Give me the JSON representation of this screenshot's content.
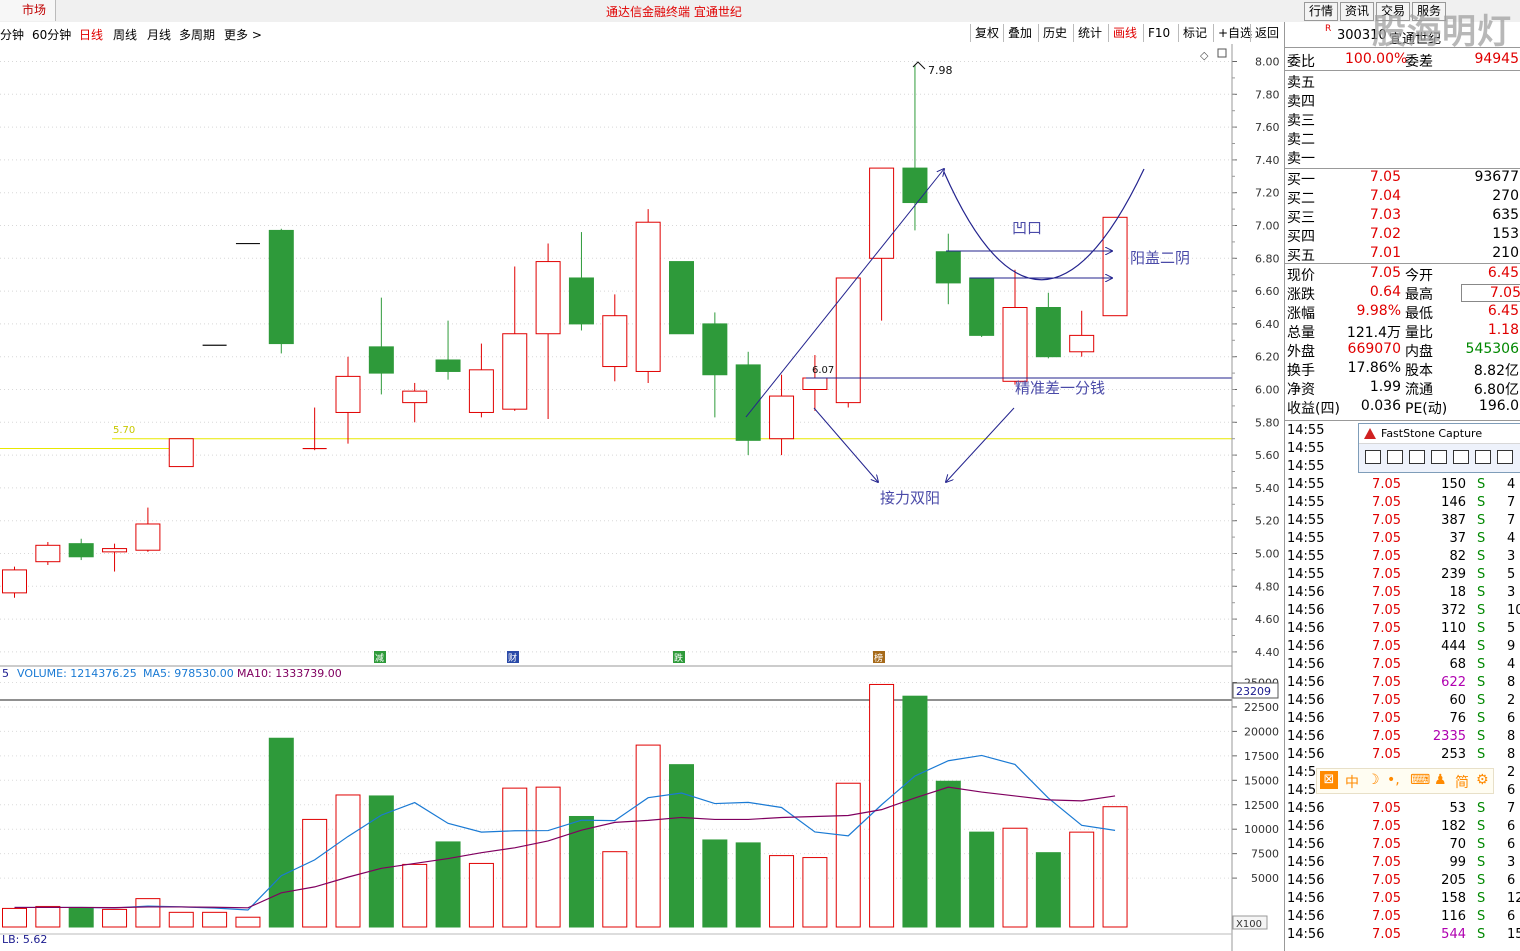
{
  "topbar": {
    "market": "市场",
    "title": "通达信金融终端  宜通世纪",
    "buttons": [
      "行情",
      "资讯",
      "交易",
      "服务"
    ]
  },
  "toolbar": {
    "periods": [
      "分钟",
      "60分钟",
      "日线",
      "周线",
      "月线",
      "多周期",
      "更多 >"
    ],
    "active_period": "日线",
    "tools": [
      "复权",
      "叠加",
      "历史",
      "统计",
      "画线",
      "F10",
      "标记",
      "+自选",
      "返回"
    ],
    "active_tool": "画线"
  },
  "colors": {
    "up": "#e00000",
    "down": "#2e9a3a",
    "support": "#e8e800",
    "drawing": "#23238e",
    "ma5": "#1a7ad4",
    "ma10": "#800060"
  },
  "price_axis": {
    "ticks": [
      "8.00",
      "7.80",
      "7.60",
      "7.40",
      "7.20",
      "7.00",
      "6.80",
      "6.60",
      "6.40",
      "6.20",
      "6.00",
      "5.80",
      "5.60",
      "5.40",
      "5.20",
      "5.00",
      "4.80",
      "4.60",
      "4.40"
    ]
  },
  "volume_axis": {
    "ticks": [
      "25000",
      "22500",
      "20000",
      "17500",
      "15000",
      "12500",
      "10000",
      "7500",
      "5000"
    ],
    "unit": "X100",
    "cursor_value": "23209"
  },
  "chart_data": {
    "type": "candlestick",
    "candles": [
      {
        "o": 4.76,
        "c": 4.9,
        "h": 4.92,
        "l": 4.73
      },
      {
        "o": 4.95,
        "c": 5.05,
        "h": 5.07,
        "l": 4.93
      },
      {
        "o": 5.06,
        "c": 4.98,
        "h": 5.09,
        "l": 4.96
      },
      {
        "o": 5.01,
        "c": 5.03,
        "h": 5.06,
        "l": 4.89
      },
      {
        "o": 5.02,
        "c": 5.18,
        "h": 5.28,
        "l": 5.01
      },
      {
        "o": 5.53,
        "c": 5.7,
        "h": 5.7,
        "l": 5.53
      },
      {
        "o": 6.27,
        "c": 6.27,
        "h": 6.27,
        "l": 6.27
      },
      {
        "o": 6.89,
        "c": 6.89,
        "h": 6.89,
        "l": 6.89
      },
      {
        "o": 6.97,
        "c": 6.28,
        "h": 6.98,
        "l": 6.22
      },
      {
        "o": 5.64,
        "c": 5.64,
        "h": 5.89,
        "l": 5.63
      },
      {
        "o": 5.86,
        "c": 6.08,
        "h": 6.2,
        "l": 5.67
      },
      {
        "o": 6.26,
        "c": 6.1,
        "h": 6.56,
        "l": 5.97
      },
      {
        "o": 5.92,
        "c": 5.99,
        "h": 6.04,
        "l": 5.8
      },
      {
        "o": 6.18,
        "c": 6.11,
        "h": 6.42,
        "l": 6.06
      },
      {
        "o": 5.86,
        "c": 6.12,
        "h": 6.28,
        "l": 5.83
      },
      {
        "o": 5.88,
        "c": 6.34,
        "h": 6.75,
        "l": 5.87
      },
      {
        "o": 6.34,
        "c": 6.78,
        "h": 6.89,
        "l": 5.82
      },
      {
        "o": 6.68,
        "c": 6.4,
        "h": 6.96,
        "l": 6.36
      },
      {
        "o": 6.14,
        "c": 6.45,
        "h": 6.58,
        "l": 6.05
      },
      {
        "o": 6.11,
        "c": 7.02,
        "h": 7.1,
        "l": 6.04
      },
      {
        "o": 6.78,
        "c": 6.34,
        "h": 6.78,
        "l": 6.34
      },
      {
        "o": 6.4,
        "c": 6.09,
        "h": 6.47,
        "l": 5.83
      },
      {
        "o": 6.15,
        "c": 5.69,
        "h": 6.23,
        "l": 5.6
      },
      {
        "o": 5.7,
        "c": 5.96,
        "h": 6.09,
        "l": 5.6
      },
      {
        "o": 6.0,
        "c": 6.07,
        "h": 6.21,
        "l": 5.87
      },
      {
        "o": 5.92,
        "c": 6.68,
        "h": 6.68,
        "l": 5.89
      },
      {
        "o": 6.8,
        "c": 7.35,
        "h": 7.35,
        "l": 6.42
      },
      {
        "o": 7.35,
        "c": 7.14,
        "h": 7.98,
        "l": 6.97
      },
      {
        "o": 6.84,
        "c": 6.65,
        "h": 6.95,
        "l": 6.52
      },
      {
        "o": 6.68,
        "c": 6.33,
        "h": 6.68,
        "l": 6.32
      },
      {
        "o": 6.05,
        "c": 6.5,
        "h": 6.73,
        "l": 6.03
      },
      {
        "o": 6.5,
        "c": 6.2,
        "h": 6.59,
        "l": 6.19
      },
      {
        "o": 6.23,
        "c": 6.33,
        "h": 6.48,
        "l": 6.2
      },
      {
        "o": 6.45,
        "c": 7.05,
        "h": 7.05,
        "l": 6.45
      }
    ],
    "volumes": [
      1900,
      2100,
      2000,
      1800,
      2900,
      1500,
      1500,
      1000,
      19300,
      11000,
      13500,
      13400,
      6400,
      8700,
      6500,
      14200,
      14300,
      11300,
      7700,
      18600,
      16600,
      8900,
      8600,
      7300,
      7100,
      14700,
      24800,
      23600,
      14900,
      9700,
      10100,
      7600,
      9700,
      12300
    ],
    "ma5": [
      2000,
      2000,
      2000,
      1950,
      2140,
      2060,
      1940,
      1740,
      5240,
      6860,
      9260,
      11440,
      12720,
      10600,
      9700,
      9840,
      9860,
      10920,
      10880,
      13220,
      13700,
      12620,
      12740,
      12220,
      9720,
      9320,
      12500,
      15440,
      17000,
      17540,
      16620,
      13180,
      10400,
      9880
    ],
    "ma10": [
      2000,
      2000,
      2000,
      1980,
      2050,
      2050,
      2020,
      1960,
      3500,
      4100,
      5100,
      6000,
      6500,
      7000,
      7600,
      8100,
      8800,
      9900,
      10700,
      10900,
      11200,
      11000,
      11000,
      11200,
      11300,
      11400,
      12000,
      13200,
      14300,
      13800,
      13400,
      13000,
      12900,
      13400
    ]
  },
  "header": {
    "volume_label": "VOLUME: 1214376.25",
    "ma5_label": "MA5: 978530.00",
    "ma10_label": "MA10: 1333739.00",
    "left_edge": "5",
    "bottom_left": "LB: 5.62"
  },
  "annotations": {
    "high_label": "7.98",
    "support_label": "5.70",
    "level_label": "6.07",
    "notch": "凹口",
    "cover": "阳盖二阴",
    "precise": "精准差一分钱",
    "relay": "接力双阳",
    "event_markers": [
      "减",
      "财",
      "跌",
      "榜"
    ]
  },
  "quote": {
    "code": "300310",
    "name": "宜通世纪",
    "wb_label": "委比",
    "wb_value": "100.00%",
    "wc_label": "委差",
    "wc_value": "94945",
    "sells": [
      {
        "label": "卖五",
        "price": "",
        "vol": ""
      },
      {
        "label": "卖四",
        "price": "",
        "vol": ""
      },
      {
        "label": "卖三",
        "price": "",
        "vol": ""
      },
      {
        "label": "卖二",
        "price": "",
        "vol": ""
      },
      {
        "label": "卖一",
        "price": "",
        "vol": ""
      }
    ],
    "buys": [
      {
        "label": "买一",
        "price": "7.05",
        "vol": "93677"
      },
      {
        "label": "买二",
        "price": "7.04",
        "vol": "270"
      },
      {
        "label": "买三",
        "price": "7.03",
        "vol": "635"
      },
      {
        "label": "买四",
        "price": "7.02",
        "vol": "153"
      },
      {
        "label": "买五",
        "price": "7.01",
        "vol": "210"
      }
    ],
    "stats": [
      {
        "l1": "现价",
        "v1": "7.05",
        "c1": "red",
        "l2": "今开",
        "v2": "6.45",
        "c2": "red"
      },
      {
        "l1": "涨跌",
        "v1": "0.64",
        "c1": "red",
        "l2": "最高",
        "v2": "7.05",
        "c2": "red"
      },
      {
        "l1": "涨幅",
        "v1": "9.98%",
        "c1": "red",
        "l2": "最低",
        "v2": "6.45",
        "c2": "red"
      },
      {
        "l1": "总量",
        "v1": "121.4万",
        "c1": "black",
        "l2": "量比",
        "v2": "1.18",
        "c2": "red"
      },
      {
        "l1": "外盘",
        "v1": "669070",
        "c1": "red",
        "l2": "内盘",
        "v2": "545306",
        "c2": "green"
      },
      {
        "l1": "换手",
        "v1": "17.86%",
        "c1": "black",
        "l2": "股本",
        "v2": "8.82亿",
        "c2": "black"
      },
      {
        "l1": "净资",
        "v1": "1.99",
        "c1": "black",
        "l2": "流通",
        "v2": "6.80亿",
        "c2": "black"
      },
      {
        "l1": "收益(四)",
        "v1": "0.036",
        "c1": "black",
        "l2": "PE(动)",
        "v2": "196.0",
        "c2": "black"
      }
    ]
  },
  "ticks": [
    {
      "t": "14:55",
      "p": "",
      "v": "",
      "s": "",
      "n": ""
    },
    {
      "t": "14:55",
      "p": "",
      "v": "",
      "s": "",
      "n": ""
    },
    {
      "t": "14:55",
      "p": "",
      "v": "",
      "s": "",
      "n": ""
    },
    {
      "t": "14:55",
      "p": "7.05",
      "v": "150",
      "s": "S",
      "n": "4"
    },
    {
      "t": "14:55",
      "p": "7.05",
      "v": "146",
      "s": "S",
      "n": "7"
    },
    {
      "t": "14:55",
      "p": "7.05",
      "v": "387",
      "s": "S",
      "n": "7"
    },
    {
      "t": "14:55",
      "p": "7.05",
      "v": "37",
      "s": "S",
      "n": "4"
    },
    {
      "t": "14:55",
      "p": "7.05",
      "v": "82",
      "s": "S",
      "n": "3"
    },
    {
      "t": "14:55",
      "p": "7.05",
      "v": "239",
      "s": "S",
      "n": "5"
    },
    {
      "t": "14:56",
      "p": "7.05",
      "v": "18",
      "s": "S",
      "n": "3"
    },
    {
      "t": "14:56",
      "p": "7.05",
      "v": "372",
      "s": "S",
      "n": "10"
    },
    {
      "t": "14:56",
      "p": "7.05",
      "v": "110",
      "s": "S",
      "n": "5"
    },
    {
      "t": "14:56",
      "p": "7.05",
      "v": "444",
      "s": "S",
      "n": "9"
    },
    {
      "t": "14:56",
      "p": "7.05",
      "v": "68",
      "s": "S",
      "n": "4"
    },
    {
      "t": "14:56",
      "p": "7.05",
      "v": "622",
      "s": "S",
      "n": "8"
    },
    {
      "t": "14:56",
      "p": "7.05",
      "v": "60",
      "s": "S",
      "n": "2"
    },
    {
      "t": "14:56",
      "p": "7.05",
      "v": "76",
      "s": "S",
      "n": "6"
    },
    {
      "t": "14:56",
      "p": "7.05",
      "v": "2335",
      "s": "S",
      "n": "8"
    },
    {
      "t": "14:56",
      "p": "7.05",
      "v": "253",
      "s": "S",
      "n": "8"
    },
    {
      "t": "14:5",
      "p": "",
      "v": "",
      "s": "",
      "n": "2"
    },
    {
      "t": "14:56",
      "p": "7.05",
      "v": "142",
      "s": "S",
      "n": "6"
    },
    {
      "t": "14:56",
      "p": "7.05",
      "v": "53",
      "s": "S",
      "n": "7"
    },
    {
      "t": "14:56",
      "p": "7.05",
      "v": "182",
      "s": "S",
      "n": "6"
    },
    {
      "t": "14:56",
      "p": "7.05",
      "v": "70",
      "s": "S",
      "n": "6"
    },
    {
      "t": "14:56",
      "p": "7.05",
      "v": "99",
      "s": "S",
      "n": "3"
    },
    {
      "t": "14:56",
      "p": "7.05",
      "v": "205",
      "s": "S",
      "n": "6"
    },
    {
      "t": "14:56",
      "p": "7.05",
      "v": "158",
      "s": "S",
      "n": "12"
    },
    {
      "t": "14:56",
      "p": "7.05",
      "v": "116",
      "s": "S",
      "n": "6"
    },
    {
      "t": "14:56",
      "p": "7.05",
      "v": "544",
      "s": "S",
      "n": "15"
    }
  ],
  "fastStone": {
    "title": "FastStone Capture"
  },
  "ime": [
    "中",
    "简"
  ],
  "watermark": "股海明灯"
}
